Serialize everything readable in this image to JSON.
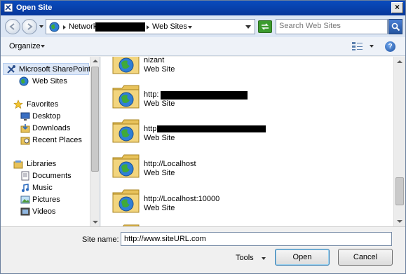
{
  "window": {
    "title": "Open Site"
  },
  "address": {
    "crumbs": [
      "Network",
      "Web Sites"
    ]
  },
  "search": {
    "placeholder": "Search Web Sites"
  },
  "toolbar": {
    "organize_label": "Organize"
  },
  "nav_pane": {
    "items": [
      {
        "label": "Microsoft SharePoint",
        "icon": "sharepoint-tools-icon"
      },
      {
        "label": "Web Sites",
        "icon": "globe-icon"
      },
      {
        "label": "Favorites",
        "icon": "star-icon"
      },
      {
        "label": "Desktop",
        "icon": "desktop-icon"
      },
      {
        "label": "Downloads",
        "icon": "downloads-icon"
      },
      {
        "label": "Recent Places",
        "icon": "recent-places-icon"
      },
      {
        "label": "Libraries",
        "icon": "libraries-icon"
      },
      {
        "label": "Documents",
        "icon": "documents-icon"
      },
      {
        "label": "Music",
        "icon": "music-icon"
      },
      {
        "label": "Pictures",
        "icon": "pictures-icon"
      },
      {
        "label": "Videos",
        "icon": "videos-icon"
      }
    ]
  },
  "content": {
    "entries": [
      {
        "name": "nizant",
        "type": "Web Site"
      },
      {
        "name": "http:",
        "type": "Web Site"
      },
      {
        "name": "http",
        "type": "Web Site"
      },
      {
        "name": "http://Localhost",
        "type": "Web Site"
      },
      {
        "name": "http://Localhost:10000",
        "type": "Web Site"
      }
    ]
  },
  "bottom": {
    "site_name_label": "Site name:",
    "site_name_value": "http://www.siteURL.com",
    "tools_label": "Tools",
    "open_label": "Open",
    "cancel_label": "Cancel"
  },
  "colors": {
    "titlebar": "#0a4bbd",
    "selection": "#dce7f7",
    "folder": "#e8c25a",
    "globe": "#2f7fd6"
  }
}
